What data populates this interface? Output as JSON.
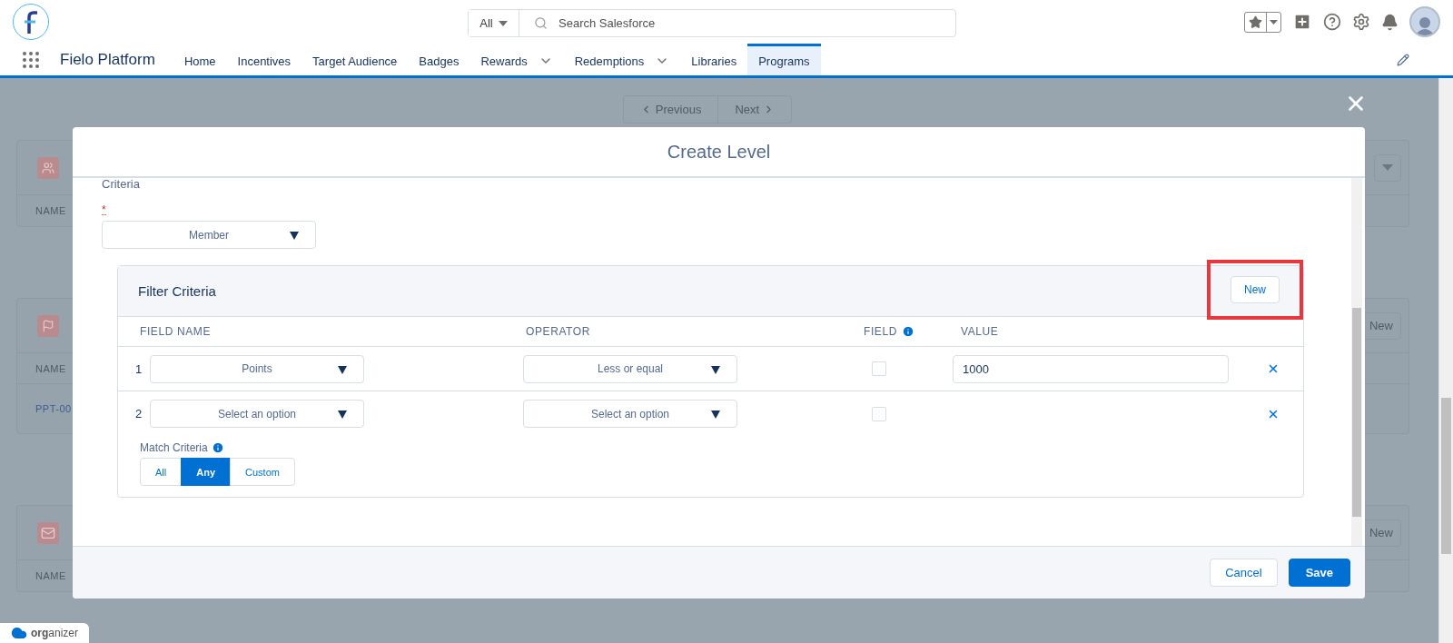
{
  "header": {
    "search_scope": "All",
    "search_placeholder": "Search Salesforce"
  },
  "nav": {
    "app_name": "Fielo Platform",
    "tabs": [
      {
        "label": "Home",
        "selected": false,
        "menu": false
      },
      {
        "label": "Incentives",
        "selected": false,
        "menu": false
      },
      {
        "label": "Target Audience",
        "selected": false,
        "menu": false
      },
      {
        "label": "Badges",
        "selected": false,
        "menu": false
      },
      {
        "label": "Rewards",
        "selected": false,
        "menu": true
      },
      {
        "label": "Redemptions",
        "selected": false,
        "menu": true
      },
      {
        "label": "Libraries",
        "selected": false,
        "menu": false
      },
      {
        "label": "Programs",
        "selected": true,
        "menu": false
      }
    ]
  },
  "background": {
    "pagination": [
      "Previous",
      "Next"
    ],
    "cards": [
      {
        "kind": "people",
        "column": "NAME",
        "has_menu": true
      },
      {
        "kind": "flag",
        "column": "NAME",
        "row": "PPT-00",
        "action": "New"
      },
      {
        "kind": "mail",
        "column": "NAME",
        "action": "New"
      }
    ]
  },
  "modal": {
    "title": "Create Level",
    "section_title": "Criteria",
    "required_mark": "*",
    "object_select": "Member",
    "filter": {
      "title": "Filter Criteria",
      "new_button": "New",
      "highlighted": true,
      "columns": [
        "FIELD NAME",
        "OPERATOR",
        "FIELD",
        "VALUE"
      ],
      "rows": [
        {
          "number": "1",
          "field": "Points",
          "operator": "Less or equal",
          "field_checked": false,
          "value": "1000"
        },
        {
          "number": "2",
          "field": "Select an option",
          "operator": "Select an option",
          "field_checked": false
        }
      ],
      "match_label": "Match Criteria",
      "match_options": [
        {
          "label": "All",
          "selected": false
        },
        {
          "label": "Any",
          "selected": true
        },
        {
          "label": "Custom",
          "selected": false
        }
      ]
    },
    "cancel": "Cancel",
    "save": "Save"
  },
  "organizer": "**org**anizer"
}
